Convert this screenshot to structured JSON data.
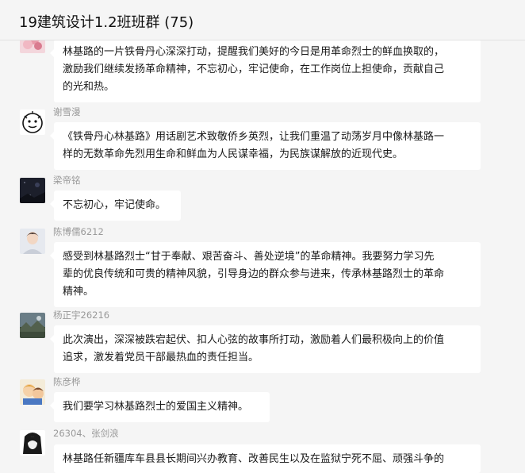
{
  "window": {
    "title": "19建筑设计1.2班班群 (75)"
  },
  "messages": [
    {
      "sender": "",
      "avatar_icon": "pink-flower-avatar-icon",
      "lines": [
        "林基路的一片铁骨丹心深深打动，提醒我们美好的今日是用革命烈士的鲜血换取的，",
        "激励我们继续发扬革命精神，不忘初心，牢记使命，在工作岗位上担使命，贡献自己",
        "的光和热。"
      ]
    },
    {
      "sender": "谢雪漫",
      "avatar_icon": "cartoon-face-avatar-icon",
      "lines": [
        "《铁骨丹心林基路》用话剧艺术致敬侨乡英烈，让我们重温了动荡岁月中像林基路一",
        "样的无数革命先烈用生命和鲜血为人民谋幸福，为民族谋解放的近现代史。"
      ]
    },
    {
      "sender": "梁帝铭",
      "avatar_icon": "night-sky-avatar-icon",
      "lines": [
        "不忘初心，牢记使命。"
      ]
    },
    {
      "sender": "陈博儒6212",
      "avatar_icon": "person-photo-avatar-icon",
      "lines": [
        "感受到林基路烈士“甘于奉献、艰苦奋斗、善处逆境”的革命精神。我要努力学习先",
        "辈的优良传统和可贵的精神风貌，引导身边的群众参与进来，传承林基路烈士的革命",
        "精神。"
      ]
    },
    {
      "sender": "杨正宇26216",
      "avatar_icon": "landscape-avatar-icon",
      "lines": [
        "此次演出，深深被跌宕起伏、扣人心弦的故事所打动，激励着人们最积极向上的价值",
        "追求，激发着党员干部最热血的责任担当。"
      ]
    },
    {
      "sender": "陈彦桦",
      "avatar_icon": "cartoon-character-avatar-icon",
      "lines": [
        "我们要学习林基路烈士的爱国主义精神。"
      ]
    },
    {
      "sender": "26304、张剑浪",
      "avatar_icon": "anime-avatar-icon",
      "lines": [
        "林基路任新疆库车县县长期间兴办教育、改善民生以及在监狱宁死不屈、顽强斗争的"
      ]
    }
  ]
}
